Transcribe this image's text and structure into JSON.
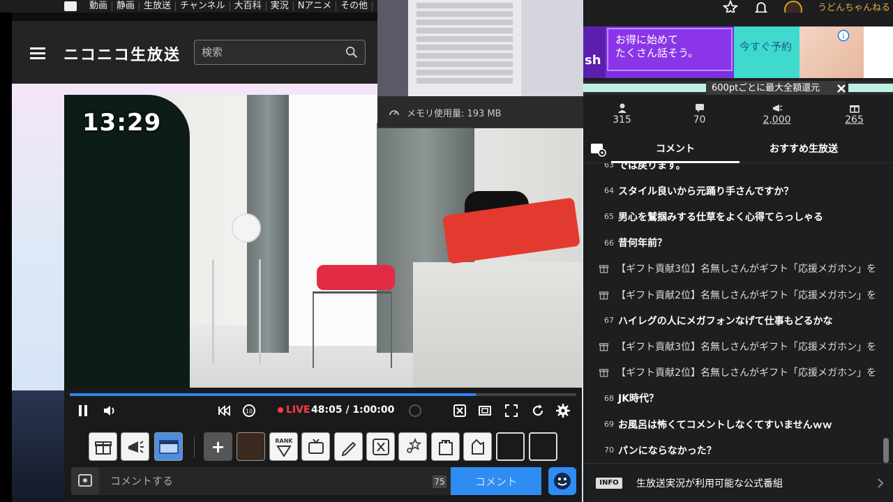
{
  "topnav": {
    "items": [
      "動画",
      "静画",
      "生放送",
      "チャンネル",
      "大百科",
      "実況",
      "Nアニメ",
      "その他"
    ],
    "username": "うどんちゃんねる"
  },
  "header": {
    "site_title": "ニコニコ生放送",
    "search_placeholder": "検索"
  },
  "video": {
    "clock": "13:29"
  },
  "player": {
    "live_label": "LIVE",
    "time": "48:05 / 1:00:00",
    "progress": 0.8014
  },
  "toolbar": {
    "rank_label": "RANK"
  },
  "comment_input": {
    "placeholder": "コメントする",
    "count": "75",
    "submit_label": "コメント"
  },
  "popup": {
    "memory_text": "メモリ使用量: 193 MB"
  },
  "ad": {
    "brand_partial": "sh",
    "line1": "お得に始めて",
    "line2": "たくさん話そう。",
    "cta": "今すぐ予約",
    "refund_text": "600ptごとに最大全額還元"
  },
  "stats": {
    "viewers": "315",
    "comments": "70",
    "ad_points": "2,000",
    "gifts": "265"
  },
  "tabs": {
    "comments": "コメント",
    "recommended": "おすすめ生放送"
  },
  "comments": [
    {
      "no": "63",
      "text": "では戻ります。",
      "gift": false
    },
    {
      "no": "64",
      "text": "スタイル良いから元踊り手さんですか？",
      "gift": false
    },
    {
      "no": "65",
      "text": "男心を鷲掴みする仕草をよく心得てらっしゃる",
      "gift": false
    },
    {
      "no": "66",
      "text": "昔何年前？",
      "gift": false
    },
    {
      "no": "",
      "text": "【ギフト貢献3位】名無しさんがギフト「応援メガホン」を",
      "gift": true
    },
    {
      "no": "",
      "text": "【ギフト貢献2位】名無しさんがギフト「応援メガホン」を",
      "gift": true
    },
    {
      "no": "67",
      "text": "ハイレグの人にメガフォンなげて仕事もどるかな",
      "gift": false
    },
    {
      "no": "",
      "text": "【ギフト貢献3位】名無しさんがギフト「応援メガホン」を",
      "gift": true
    },
    {
      "no": "",
      "text": "【ギフト貢献2位】名無しさんがギフト「応援メガホン」を",
      "gift": true
    },
    {
      "no": "68",
      "text": "JK時代？",
      "gift": false
    },
    {
      "no": "69",
      "text": "お風呂は怖くてコメントしなくてすいませんｗｗ",
      "gift": false
    },
    {
      "no": "70",
      "text": "パンにならなかった？",
      "gift": false
    }
  ],
  "info_bar": {
    "badge": "INFO",
    "text": "生放送実況が利用可能な公式番組"
  },
  "colors": {
    "accent_blue": "#2f8cf2",
    "live_red": "#ff3b4b",
    "username_gold": "#e0b341"
  }
}
